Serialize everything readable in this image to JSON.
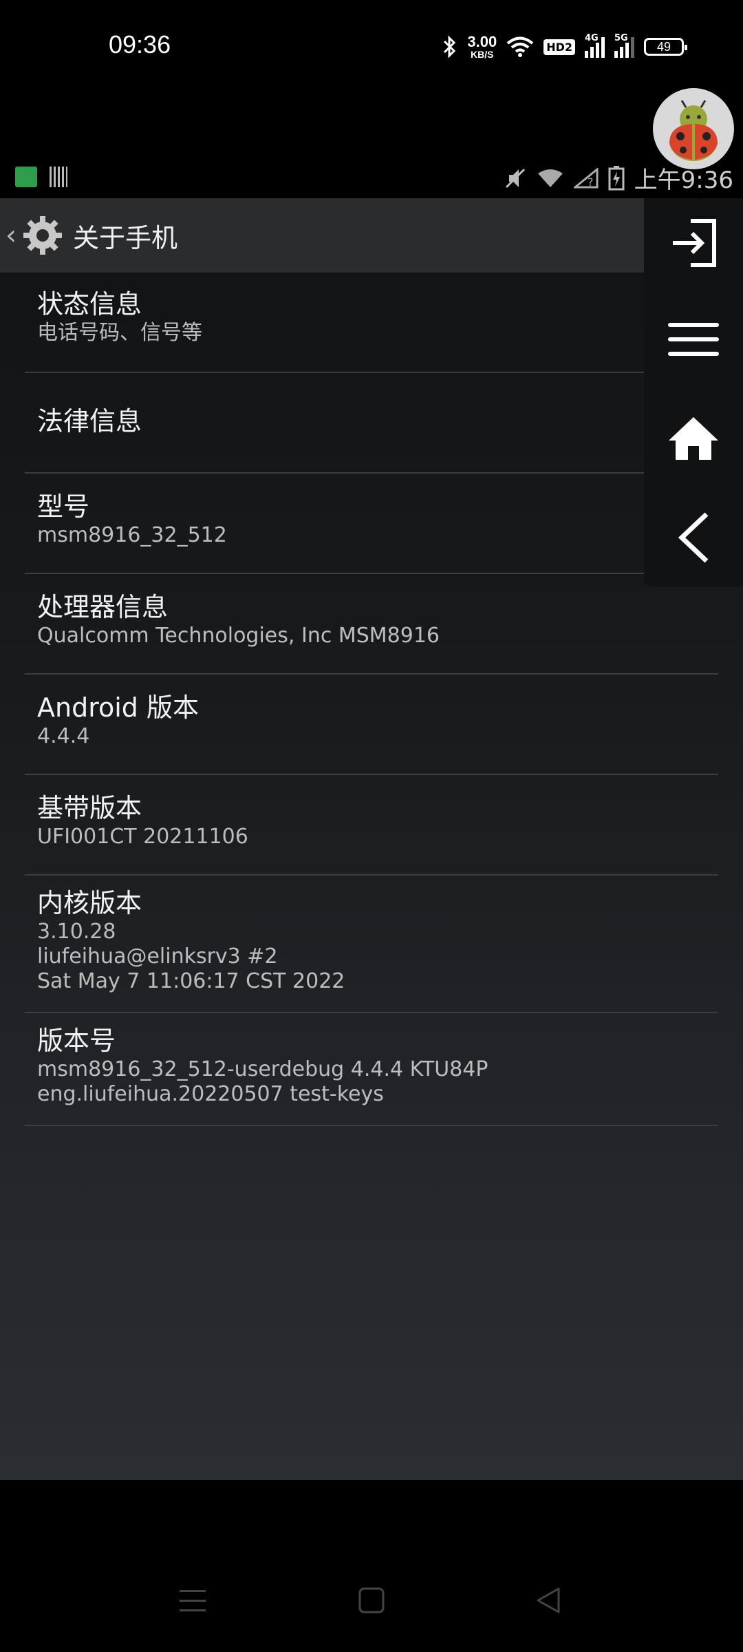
{
  "system_status": {
    "time": "09:36",
    "net_speed_value": "3.00",
    "net_speed_unit": "KB/S",
    "hd_label": "HD2",
    "signal1_label": "4G",
    "signal2_label": "5G",
    "battery": "49"
  },
  "inner_status": {
    "time": "上午9:36"
  },
  "action_bar": {
    "title": "关于手机"
  },
  "items": [
    {
      "title": "状态信息",
      "summary": [
        "电话号码、信号等"
      ]
    },
    {
      "title": "法律信息",
      "summary": []
    },
    {
      "title": "型号",
      "summary": [
        "msm8916_32_512"
      ]
    },
    {
      "title": "处理器信息",
      "summary": [
        "Qualcomm Technologies, Inc MSM8916"
      ]
    },
    {
      "title": "Android 版本",
      "summary": [
        "4.4.4"
      ]
    },
    {
      "title": "基带版本",
      "summary": [
        "UFI001CT 20211106"
      ]
    },
    {
      "title": "内核版本",
      "summary": [
        "3.10.28",
        "liufeihua@elinksrv3 #2",
        "Sat May 7 11:06:17 CST 2022"
      ]
    },
    {
      "title": "版本号",
      "summary": [
        "msm8916_32_512-userdebug 4.4.4 KTU84P",
        "eng.liufeihua.20220507 test-keys"
      ]
    }
  ],
  "float_panel": {
    "buttons": [
      "exit-icon",
      "menu-icon",
      "home-icon",
      "back-icon"
    ]
  },
  "colors": {
    "action_bar": "#2b2c2e",
    "divider": "#3a3d41",
    "ladybug_red": "#d8452b",
    "ladybug_green": "#9aa83a"
  }
}
